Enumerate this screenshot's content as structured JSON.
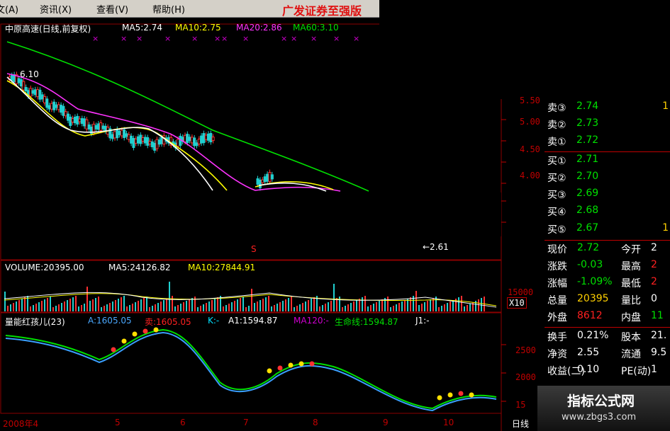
{
  "menu": {
    "items": [
      "文(A)",
      "资讯(X)",
      "查看(V)",
      "帮助(H)"
    ],
    "brand": "广发证券至强版"
  },
  "price_panel": {
    "title": "中原高速(日线,前复权)",
    "ma5": "MA5:2.74",
    "ma10": "MA10:2.75",
    "ma20": "MA20:2.86",
    "ma60": "MA60:3.10",
    "high_marker": "6.10",
    "low_marker": "←2.61",
    "s_marker": "S",
    "axis_labels": [
      "5.00",
      "4.50",
      "4.00",
      "5.50"
    ],
    "colors": {
      "ma5": "#ffffff",
      "ma10": "#ffff00",
      "ma20": "#ff33ff",
      "ma60": "#00e000"
    }
  },
  "volume_panel": {
    "volume": "VOLUME:20395.00",
    "ma5": "MA5:24126.82",
    "ma10": "MA10:27844.91",
    "axis_label": "15000",
    "multiplier": "X10"
  },
  "indicator_panel": {
    "name": "量能红孩儿(23)",
    "a": "A:1605.05",
    "sell": "卖:1605.05",
    "k": "K:-",
    "a1": "A1:1594.87",
    "ma120": "MA120:-",
    "life_line": "生命线:1594.87",
    "j1": "J1:-",
    "axis_labels": [
      "2500",
      "2000",
      "15"
    ]
  },
  "x_axis": {
    "labels": [
      "2008年4",
      "5",
      "6",
      "7",
      "8",
      "9",
      "10"
    ],
    "corner": "日线"
  },
  "quote": {
    "sell": [
      {
        "label": "卖③",
        "price": "2.74",
        "qty": "1"
      },
      {
        "label": "卖②",
        "price": "2.73",
        "qty": ""
      },
      {
        "label": "卖①",
        "price": "2.72",
        "qty": ""
      }
    ],
    "buy": [
      {
        "label": "买①",
        "price": "2.71",
        "qty": ""
      },
      {
        "label": "买②",
        "price": "2.70",
        "qty": ""
      },
      {
        "label": "买③",
        "price": "2.69",
        "qty": ""
      },
      {
        "label": "买④",
        "price": "2.68",
        "qty": ""
      },
      {
        "label": "买⑤",
        "price": "2.67",
        "qty": "1"
      }
    ],
    "stats": [
      {
        "k1": "现价",
        "v1": "2.72",
        "k2": "今开",
        "v2": "2"
      },
      {
        "k1": "涨跌",
        "v1": "-0.03",
        "k2": "最高",
        "v2": "2"
      },
      {
        "k1": "涨幅",
        "v1": "-1.09%",
        "k2": "最低",
        "v2": "2"
      },
      {
        "k1": "总量",
        "v1": "20395",
        "k2": "量比",
        "v2": "0"
      },
      {
        "k1": "外盘",
        "v1": "8612",
        "k2": "内盘",
        "v2": "11"
      },
      {
        "k1": "换手",
        "v1": "0.21%",
        "k2": "股本",
        "v2": "21."
      },
      {
        "k1": "净资",
        "v1": "2.55",
        "k2": "流通",
        "v2": "9.5"
      },
      {
        "k1": "收益(二)",
        "v1": "0.10",
        "k2": "PE(动)",
        "v2": "1"
      }
    ]
  },
  "watermark": {
    "title": "指标公式网",
    "url": "www.zbgs3.com"
  }
}
